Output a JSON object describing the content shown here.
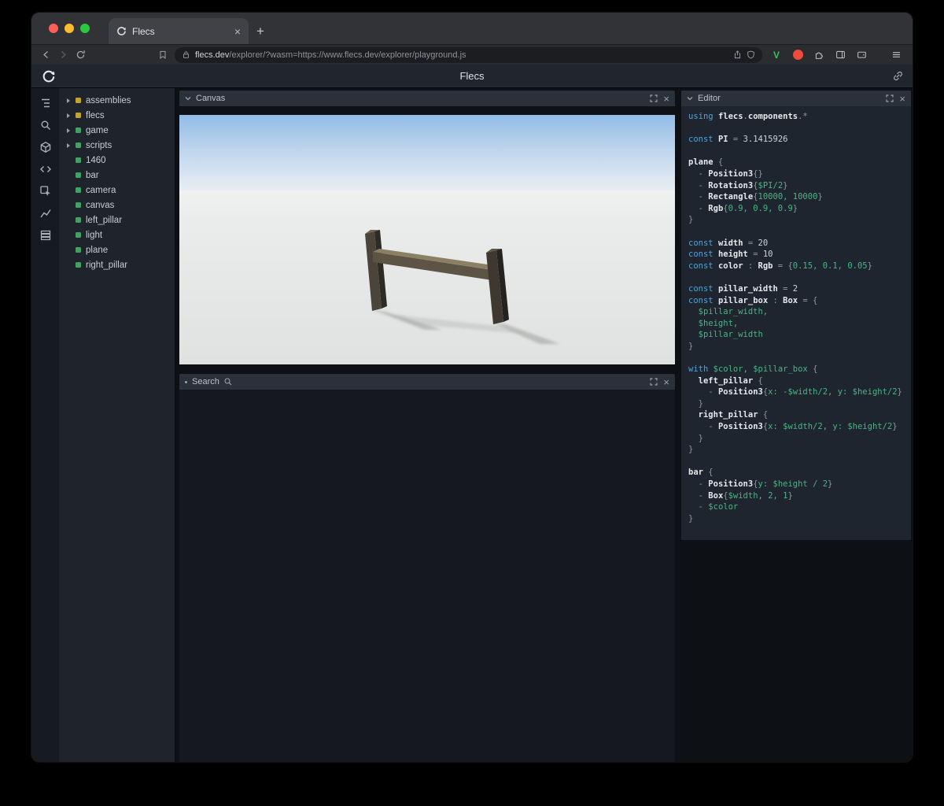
{
  "colors": {
    "keyword_blue": "#54a1d8",
    "value_green": "#49b584",
    "dot_yellow": "#c2a530",
    "dot_green": "#42a263",
    "ext_v_green": "#35c258",
    "ext_badge_red": "#f0493d",
    "traffic_red": "#ff5f57",
    "traffic_yellow": "#febc2e",
    "traffic_green": "#28c840"
  },
  "browser": {
    "tab_title": "Flecs",
    "close_tab_glyph": "×",
    "new_tab_glyph": "+",
    "url_domain": "flecs.dev",
    "url_path": "/explorer/?wasm=https://www.flecs.dev/explorer/playground.js",
    "extension_v_label": "V"
  },
  "app": {
    "title": "Flecs"
  },
  "panels": {
    "canvas_title": "Canvas",
    "search_title": "Search",
    "editor_title": "Editor",
    "close_glyph": "×"
  },
  "tree": {
    "items": [
      {
        "label": "assemblies",
        "expandable": true,
        "dot": "dot_yellow"
      },
      {
        "label": "flecs",
        "expandable": true,
        "dot": "dot_yellow"
      },
      {
        "label": "game",
        "expandable": true,
        "dot": "dot_green"
      },
      {
        "label": "scripts",
        "expandable": true,
        "dot": "dot_green"
      },
      {
        "label": "1460",
        "expandable": false,
        "dot": "dot_green"
      },
      {
        "label": "bar",
        "expandable": false,
        "dot": "dot_green"
      },
      {
        "label": "camera",
        "expandable": false,
        "dot": "dot_green"
      },
      {
        "label": "canvas",
        "expandable": false,
        "dot": "dot_green"
      },
      {
        "label": "left_pillar",
        "expandable": false,
        "dot": "dot_green"
      },
      {
        "label": "light",
        "expandable": false,
        "dot": "dot_green"
      },
      {
        "label": "plane",
        "expandable": false,
        "dot": "dot_green"
      },
      {
        "label": "right_pillar",
        "expandable": false,
        "dot": "dot_green"
      }
    ]
  },
  "editor": {
    "lines": [
      [
        [
          "k",
          "using"
        ],
        [
          "n",
          " "
        ],
        [
          "i",
          "flecs"
        ],
        [
          "p",
          "."
        ],
        [
          "i",
          "components"
        ],
        [
          "p",
          "."
        ],
        [
          "p",
          "*"
        ]
      ],
      [],
      [
        [
          "k",
          "const"
        ],
        [
          "n",
          " "
        ],
        [
          "i",
          "PI"
        ],
        [
          "p",
          " = "
        ],
        [
          "n",
          "3.1415926"
        ]
      ],
      [],
      [
        [
          "i",
          "plane"
        ],
        [
          "p",
          " {"
        ]
      ],
      [
        [
          "p",
          "  - "
        ],
        [
          "i",
          "Position3"
        ],
        [
          "p",
          "{}"
        ]
      ],
      [
        [
          "p",
          "  - "
        ],
        [
          "i",
          "Rotation3"
        ],
        [
          "p",
          "{"
        ],
        [
          "g",
          "$PI/2"
        ],
        [
          "p",
          "}"
        ]
      ],
      [
        [
          "p",
          "  - "
        ],
        [
          "i",
          "Rectangle"
        ],
        [
          "p",
          "{"
        ],
        [
          "g",
          "10000, 10000"
        ],
        [
          "p",
          "}"
        ]
      ],
      [
        [
          "p",
          "  - "
        ],
        [
          "i",
          "Rgb"
        ],
        [
          "p",
          "{"
        ],
        [
          "g",
          "0.9, 0.9, 0.9"
        ],
        [
          "p",
          "}"
        ]
      ],
      [
        [
          "p",
          "}"
        ]
      ],
      [],
      [
        [
          "k",
          "const"
        ],
        [
          "n",
          " "
        ],
        [
          "i",
          "width"
        ],
        [
          "p",
          " = "
        ],
        [
          "n",
          "20"
        ]
      ],
      [
        [
          "k",
          "const"
        ],
        [
          "n",
          " "
        ],
        [
          "i",
          "height"
        ],
        [
          "p",
          " = "
        ],
        [
          "n",
          "10"
        ]
      ],
      [
        [
          "k",
          "const"
        ],
        [
          "n",
          " "
        ],
        [
          "i",
          "color"
        ],
        [
          "p",
          " : "
        ],
        [
          "i",
          "Rgb"
        ],
        [
          "p",
          " = {"
        ],
        [
          "g",
          "0.15, 0.1, 0.05"
        ],
        [
          "p",
          "}"
        ]
      ],
      [],
      [
        [
          "k",
          "const"
        ],
        [
          "n",
          " "
        ],
        [
          "i",
          "pillar_width"
        ],
        [
          "p",
          " = "
        ],
        [
          "n",
          "2"
        ]
      ],
      [
        [
          "k",
          "const"
        ],
        [
          "n",
          " "
        ],
        [
          "i",
          "pillar_box"
        ],
        [
          "p",
          " : "
        ],
        [
          "i",
          "Box"
        ],
        [
          "p",
          " = {"
        ]
      ],
      [
        [
          "g",
          "  $pillar_width"
        ],
        [
          "p",
          ","
        ]
      ],
      [
        [
          "g",
          "  $height"
        ],
        [
          "p",
          ","
        ]
      ],
      [
        [
          "g",
          "  $pillar_width"
        ]
      ],
      [
        [
          "p",
          "}"
        ]
      ],
      [],
      [
        [
          "k",
          "with"
        ],
        [
          "n",
          " "
        ],
        [
          "g",
          "$color"
        ],
        [
          "p",
          ", "
        ],
        [
          "g",
          "$pillar_box"
        ],
        [
          "p",
          " {"
        ]
      ],
      [
        [
          "n",
          "  "
        ],
        [
          "i",
          "left_pillar"
        ],
        [
          "p",
          " {"
        ]
      ],
      [
        [
          "p",
          "    - "
        ],
        [
          "i",
          "Position3"
        ],
        [
          "p",
          "{"
        ],
        [
          "g",
          "x: -$width/2"
        ],
        [
          "p",
          ", "
        ],
        [
          "g",
          "y: $height/2"
        ],
        [
          "p",
          "}"
        ]
      ],
      [
        [
          "p",
          "  }"
        ]
      ],
      [
        [
          "n",
          "  "
        ],
        [
          "i",
          "right_pillar"
        ],
        [
          "p",
          " {"
        ]
      ],
      [
        [
          "p",
          "    - "
        ],
        [
          "i",
          "Position3"
        ],
        [
          "p",
          "{"
        ],
        [
          "g",
          "x: $width/2"
        ],
        [
          "p",
          ", "
        ],
        [
          "g",
          "y: $height/2"
        ],
        [
          "p",
          "}"
        ]
      ],
      [
        [
          "p",
          "  }"
        ]
      ],
      [
        [
          "p",
          "}"
        ]
      ],
      [],
      [
        [
          "i",
          "bar"
        ],
        [
          "p",
          " {"
        ]
      ],
      [
        [
          "p",
          "  - "
        ],
        [
          "i",
          "Position3"
        ],
        [
          "p",
          "{"
        ],
        [
          "g",
          "y: $height / 2"
        ],
        [
          "p",
          "}"
        ]
      ],
      [
        [
          "p",
          "  - "
        ],
        [
          "i",
          "Box"
        ],
        [
          "p",
          "{"
        ],
        [
          "g",
          "$width"
        ],
        [
          "p",
          ", "
        ],
        [
          "g",
          "2, 1"
        ],
        [
          "p",
          "}"
        ]
      ],
      [
        [
          "p",
          "  - "
        ],
        [
          "g",
          "$color"
        ]
      ],
      [
        [
          "p",
          "}"
        ]
      ]
    ]
  }
}
